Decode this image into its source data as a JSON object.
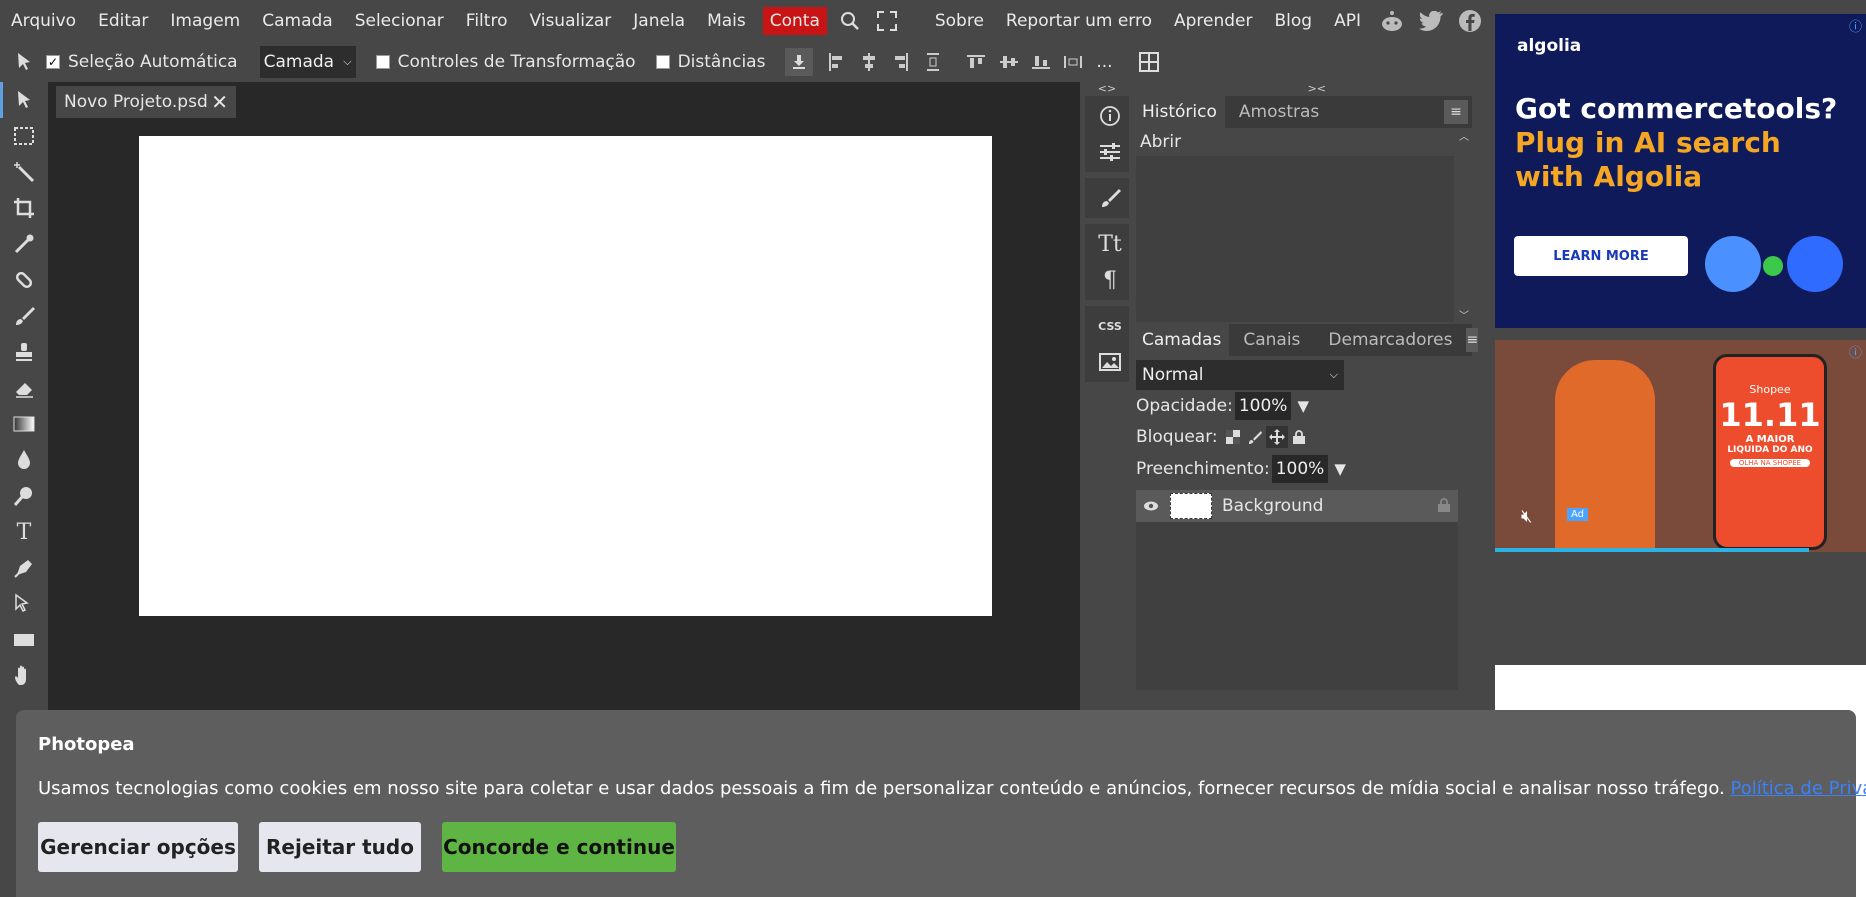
{
  "menu": {
    "items": [
      "Arquivo",
      "Editar",
      "Imagem",
      "Camada",
      "Selecionar",
      "Filtro",
      "Visualizar",
      "Janela",
      "Mais"
    ],
    "account": "Conta",
    "right_items": [
      "Sobre",
      "Reportar um erro",
      "Aprender",
      "Blog",
      "API"
    ]
  },
  "options": {
    "auto_select": "Seleção Automática",
    "layer_select": "Camada",
    "transform_controls": "Controles de Transformação",
    "distances": "Distâncias",
    "more": "..."
  },
  "document_tab": {
    "title": "Novo Projeto.psd"
  },
  "panels": {
    "collapse_left": "<>",
    "collapse_right": "><",
    "history_tabs": [
      "Histórico",
      "Amostras"
    ],
    "history_items": [
      "Abrir"
    ],
    "layers_tabs": [
      "Camadas",
      "Canais",
      "Demarcadores"
    ],
    "blend_mode": "Normal",
    "opacity_label": "Opacidade:",
    "opacity_value": "100%",
    "lock_label": "Bloquear:",
    "fill_label": "Preenchimento:",
    "fill_value": "100%",
    "layers": [
      {
        "name": "Background"
      }
    ]
  },
  "ads": {
    "ad1": {
      "brand": "algolia",
      "headline1": "Got commercetools?",
      "headline2": "Plug in AI search",
      "headline3": "with Algolia",
      "cta": "LEARN MORE"
    },
    "ad2": {
      "brand": "Shopee",
      "big": "11.11",
      "sub1": "A MAIOR",
      "sub2": "LIQUIDA DO ANO",
      "cta": "OLHA NA SHOPEE",
      "tag": "Ad"
    }
  },
  "cookie": {
    "title": "Photopea",
    "text": "Usamos tecnologias como cookies em nosso site para coletar e usar dados pessoais a fim de personalizar conteúdo e anúncios, fornecer recursos de mídia social e analisar nosso tráfego.",
    "link": "Política de Privacidade",
    "btn_manage": "Gerenciar opções",
    "btn_reject": "Rejeitar tudo",
    "btn_accept": "Concorde e continue"
  },
  "colors": {
    "accent_red": "#c81414",
    "accept_green": "#5fb544",
    "link_blue": "#3b82f6"
  }
}
